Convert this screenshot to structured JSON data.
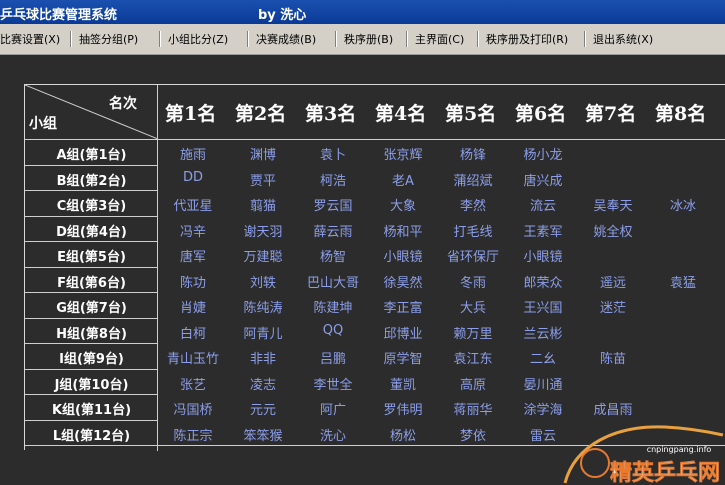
{
  "window": {
    "title": "乒乓球比赛管理系统",
    "author": "by 洗心"
  },
  "menu": [
    {
      "label": "比赛设置(X)",
      "name": "menu-match-settings"
    },
    {
      "label": "抽签分组(P)",
      "name": "menu-draw-groups"
    },
    {
      "label": "小组比分(Z)",
      "name": "menu-group-scores"
    },
    {
      "label": "决赛成绩(B)",
      "name": "menu-final-results"
    },
    {
      "label": "秩序册(B)",
      "name": "menu-program-book"
    },
    {
      "label": "主界面(C)",
      "name": "menu-main-screen"
    },
    {
      "label": "秩序册及打印(R)",
      "name": "menu-program-print"
    },
    {
      "label": "退出系统(X)",
      "name": "menu-exit"
    }
  ],
  "table": {
    "corner_top": "名次",
    "corner_bottom": "小组",
    "headers": [
      "第1名",
      "第2名",
      "第3名",
      "第4名",
      "第5名",
      "第6名",
      "第7名",
      "第8名"
    ],
    "rows": [
      {
        "group": "A组(第1台)",
        "players": [
          "施雨",
          "渊博",
          "袁卜",
          "张京辉",
          "杨锋",
          "杨小龙",
          "",
          ""
        ]
      },
      {
        "group": "B组(第2台)",
        "players": [
          "DD",
          "贾平",
          "柯浩",
          "老A",
          "蒲绍斌",
          "唐兴成",
          "",
          ""
        ]
      },
      {
        "group": "C组(第3台)",
        "players": [
          "代亚星",
          "翦猫",
          "罗云国",
          "大象",
          "李然",
          "流云",
          "吴奉天",
          "冰冰"
        ]
      },
      {
        "group": "D组(第4台)",
        "players": [
          "冯辛",
          "谢天羽",
          "薛云雨",
          "杨和平",
          "打毛线",
          "王素军",
          "姚全权",
          ""
        ]
      },
      {
        "group": "E组(第5台)",
        "players": [
          "唐军",
          "万建聪",
          "杨智",
          "小眼镜",
          "省环保厅",
          "小眼镜",
          "",
          ""
        ]
      },
      {
        "group": "F组(第6台)",
        "players": [
          "陈功",
          "刘轶",
          "巴山大哥",
          "徐昊然",
          "冬雨",
          "郎荣众",
          "遥远",
          "袁猛"
        ]
      },
      {
        "group": "G组(第7台)",
        "players": [
          "肖婕",
          "陈纯涛",
          "陈建坤",
          "李正富",
          "大兵",
          "王兴国",
          "迷茫",
          ""
        ]
      },
      {
        "group": "H组(第8台)",
        "players": [
          "白柯",
          "阿青儿",
          "QQ",
          "邱博业",
          "赖万里",
          "兰云彬",
          "",
          ""
        ]
      },
      {
        "group": "I组(第9台)",
        "players": [
          "青山玉竹",
          "非非",
          "吕鹏",
          "原学智",
          "袁江东",
          "二幺",
          "陈苗",
          ""
        ]
      },
      {
        "group": "J组(第10台)",
        "players": [
          "张艺",
          "凌志",
          "李世全",
          "董凯",
          "高原",
          "晏川通",
          "",
          ""
        ]
      },
      {
        "group": "K组(第11台)",
        "players": [
          "冯国桥",
          "元元",
          "阿广",
          "罗伟明",
          "蒋丽华",
          "涂学海",
          "成昌雨",
          ""
        ]
      },
      {
        "group": "L组(第12台)",
        "players": [
          "陈正宗",
          "笨笨猴",
          "洗心",
          "杨松",
          "梦依",
          "雷云",
          "",
          ""
        ]
      }
    ]
  },
  "watermark": {
    "site": "cnpingpang.info",
    "brand": "精英乒乓网"
  }
}
